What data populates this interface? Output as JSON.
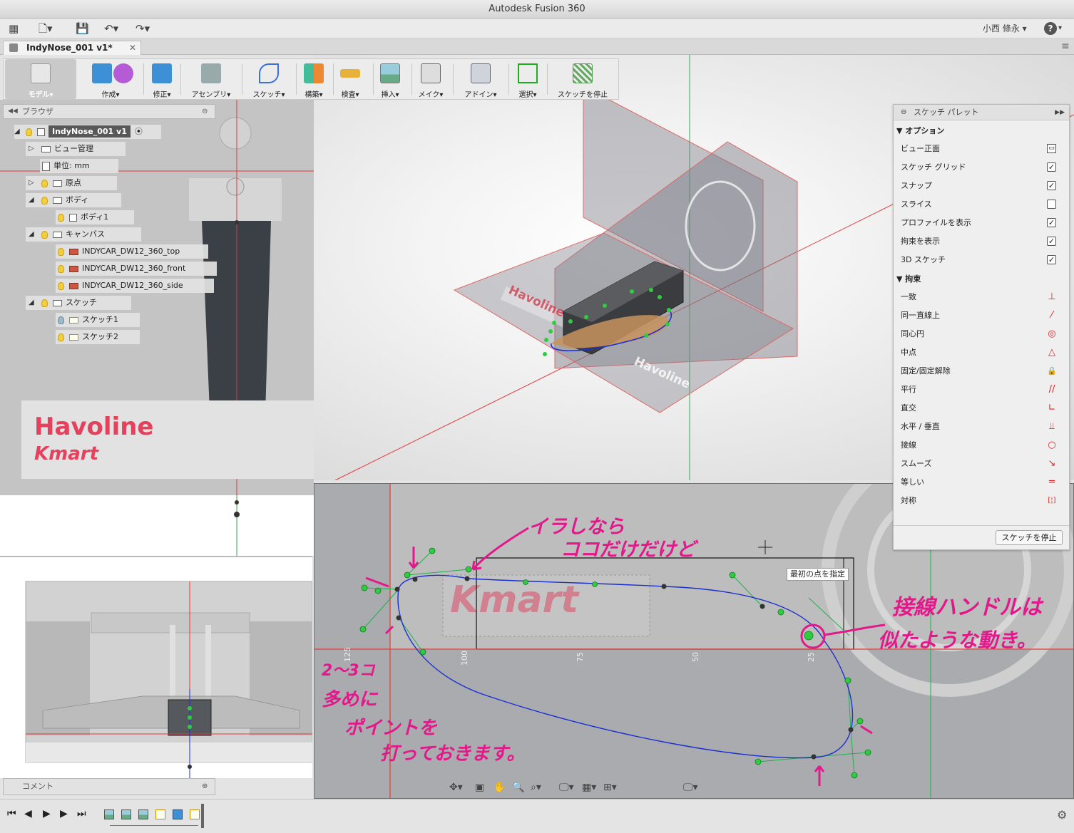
{
  "app": {
    "title": "Autodesk Fusion 360",
    "user": "小西 條永",
    "help": "?"
  },
  "document": {
    "tab_label": "IndyNose_001 v1*"
  },
  "ribbon": [
    {
      "label": "モデル▾",
      "icon": "model-cube-icon"
    },
    {
      "label": "作成▾",
      "icon": "create-box-icon"
    },
    {
      "label": "修正▾",
      "icon": "modify-icon"
    },
    {
      "label": "アセンブリ▾",
      "icon": "assemble-joint-icon"
    },
    {
      "label": "スケッチ▾",
      "icon": "sketch-spline-icon"
    },
    {
      "label": "構築▾",
      "icon": "construct-plane-icon"
    },
    {
      "label": "検査▾",
      "icon": "inspect-measure-icon"
    },
    {
      "label": "挿入▾",
      "icon": "insert-image-icon"
    },
    {
      "label": "メイク▾",
      "icon": "make-3dprint-icon"
    },
    {
      "label": "アドイン▾",
      "icon": "addins-script-icon"
    },
    {
      "label": "選択▾",
      "icon": "select-cursor-icon"
    },
    {
      "label": "スケッチを停止",
      "icon": "stop-sketch-icon"
    }
  ],
  "browser": {
    "title": "ブラウザ",
    "root": "IndyNose_001 v1",
    "items": [
      "ビュー管理",
      "単位: mm",
      "原点",
      "ボディ",
      "ボディ1",
      "キャンバス",
      "INDYCAR_DW12_360_top",
      "INDYCAR_DW12_360_front",
      "INDYCAR_DW12_360_side",
      "スケッチ",
      "スケッチ1",
      "スケッチ2"
    ]
  },
  "comments": {
    "title": "コメント"
  },
  "palette": {
    "title": "スケッチ パレット",
    "options_title": "オプション",
    "options": [
      {
        "label": "ビュー正面",
        "type": "icon"
      },
      {
        "label": "スケッチ グリッド",
        "checked": true
      },
      {
        "label": "スナップ",
        "checked": true
      },
      {
        "label": "スライス",
        "checked": false
      },
      {
        "label": "プロファイルを表示",
        "checked": true
      },
      {
        "label": "拘束を表示",
        "checked": true
      },
      {
        "label": "3D スケッチ",
        "checked": true
      }
    ],
    "constraints_title": "拘束",
    "constraints": [
      {
        "label": "一致",
        "glyph": "⊥"
      },
      {
        "label": "同一直線上",
        "glyph": "⁄"
      },
      {
        "label": "同心円",
        "glyph": "◎"
      },
      {
        "label": "中点",
        "glyph": "△"
      },
      {
        "label": "固定/固定解除",
        "glyph": "🔒"
      },
      {
        "label": "平行",
        "glyph": "//"
      },
      {
        "label": "直交",
        "glyph": "∟"
      },
      {
        "label": "水平 / 垂直",
        "glyph": "⫫"
      },
      {
        "label": "接線",
        "glyph": "○"
      },
      {
        "label": "スムーズ",
        "glyph": "↘"
      },
      {
        "label": "等しい",
        "glyph": "="
      },
      {
        "label": "対称",
        "glyph": "[¦]"
      }
    ],
    "stop_button": "スケッチを停止"
  },
  "viewport": {
    "tooltip": "最初の点を指定",
    "ruler_labels": [
      "25",
      "50",
      "75",
      "100",
      "125"
    ],
    "axis_labels_top": [
      "125",
      "100",
      "75"
    ],
    "canvas_text_havoline": "Havoline",
    "canvas_text_kmart": "Kmart"
  },
  "annotations": {
    "a1_line1": "イラしなら",
    "a1_line2": "ココだけだけど",
    "a2_line1": "接線ハンドルは",
    "a2_line2": "似たような動き。",
    "a3_line1": "2〜3コ",
    "a3_line2": "多めに",
    "a3_line3": "ポイントを",
    "a3_line4": "打っておきます。",
    "color": "#e2198b"
  },
  "colors": {
    "spline": "#1a2fd0",
    "handle": "#2ecc40",
    "axis_red": "#e23a3a",
    "axis_green": "#1fb24a"
  }
}
